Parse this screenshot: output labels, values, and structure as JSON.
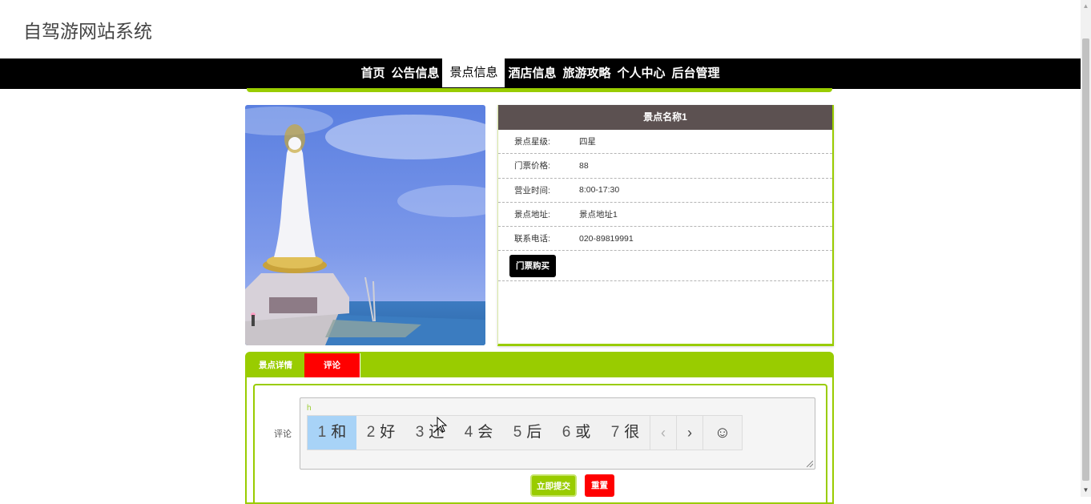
{
  "site": {
    "title": "自驾游网站系统"
  },
  "nav": {
    "items": [
      {
        "label": "首页"
      },
      {
        "label": "公告信息"
      },
      {
        "label": "景点信息"
      },
      {
        "label": "酒店信息"
      },
      {
        "label": "旅游攻略"
      },
      {
        "label": "个人中心"
      },
      {
        "label": "后台管理"
      }
    ],
    "active_index": 2
  },
  "attraction": {
    "name": "景点名称1",
    "fields": [
      {
        "label": "景点星级:",
        "value": "四星"
      },
      {
        "label": "门票价格:",
        "value": "88"
      },
      {
        "label": "营业时间:",
        "value": "8:00-17:30"
      },
      {
        "label": "景点地址:",
        "value": "景点地址1"
      },
      {
        "label": "联系电话:",
        "value": "020-89819991"
      }
    ],
    "buy_label": "门票购买"
  },
  "tabs": {
    "items": [
      {
        "label": "景点详情"
      },
      {
        "label": "评论"
      }
    ],
    "active_index": 1
  },
  "comment": {
    "label": "评论",
    "typed_text": "h",
    "ime": {
      "candidates": [
        {
          "num": "1",
          "char": "和"
        },
        {
          "num": "2",
          "char": "好"
        },
        {
          "num": "3",
          "char": "还"
        },
        {
          "num": "4",
          "char": "会"
        },
        {
          "num": "5",
          "char": "后"
        },
        {
          "num": "6",
          "char": "或"
        },
        {
          "num": "7",
          "char": "很"
        }
      ],
      "selected_index": 0,
      "prev": "‹",
      "next": "›",
      "emoji": "☺"
    },
    "submit_label": "立即提交",
    "reset_label": "重置"
  },
  "colors": {
    "accent": "#99cc00",
    "nav_bg": "#000000",
    "title_bar": "#5c5151",
    "active_tab": "#ff0000"
  }
}
